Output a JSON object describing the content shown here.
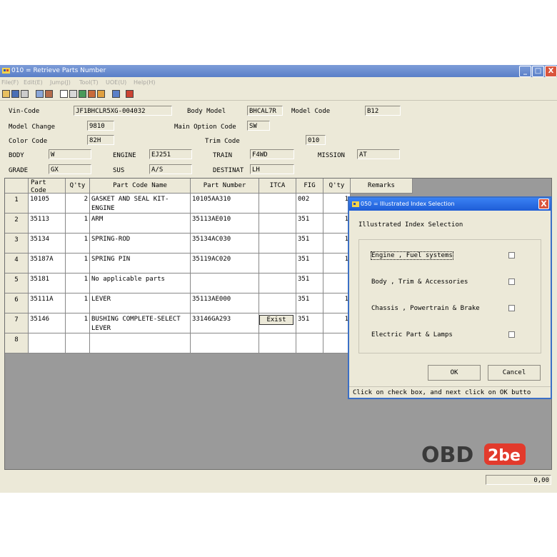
{
  "window": {
    "title": "010 = Retrieve Parts Number",
    "minimize": "_",
    "maximize": "□",
    "close": "X"
  },
  "menu": [
    "File(F)",
    "Edit(E)",
    "Jump(J)",
    "Tool(T)",
    "UOE(U)",
    "Help(H)"
  ],
  "form": {
    "vin_code": {
      "label": "Vin-Code",
      "value": "JF1BHCLR5XG-004032"
    },
    "body_model": {
      "label": "Body Model",
      "value": "BHCAL7R"
    },
    "model_code": {
      "label": "Model Code",
      "value": "B12"
    },
    "model_change": {
      "label": "Model Change",
      "value": "9810"
    },
    "main_option_code": {
      "label": "Main Option Code",
      "value": "SW"
    },
    "color_code": {
      "label": "Color Code",
      "value": "82H"
    },
    "trim_code": {
      "label": "Trim Code",
      "value": "010"
    },
    "body": {
      "label": "BODY",
      "value": "W"
    },
    "engine": {
      "label": "ENGINE",
      "value": "EJ251"
    },
    "train": {
      "label": "TRAIN",
      "value": "F4WD"
    },
    "mission": {
      "label": "MISSION",
      "value": "AT"
    },
    "grade": {
      "label": "GRADE",
      "value": "GX"
    },
    "sus": {
      "label": "SUS",
      "value": "A/S"
    },
    "destinat": {
      "label": "DESTINAT",
      "value": "LH"
    }
  },
  "table": {
    "headers": [
      "Part Code",
      "Q'ty",
      "Part Code Name",
      "Part Number",
      "ITCA",
      "FIG",
      "Q'ty",
      "Remarks"
    ],
    "rows": [
      {
        "n": "1",
        "part_code": "10105",
        "qty": "2",
        "name": "GASKET AND SEAL KIT-ENGINE",
        "part_number": "10105AA310",
        "itca": "",
        "fig": "002",
        "qty2": "1"
      },
      {
        "n": "2",
        "part_code": "35113",
        "qty": "1",
        "name": "ARM",
        "part_number": "35113AE010",
        "itca": "",
        "fig": "351",
        "qty2": "1"
      },
      {
        "n": "3",
        "part_code": "35134",
        "qty": "1",
        "name": "SPRING-ROD",
        "part_number": "35134AC030",
        "itca": "",
        "fig": "351",
        "qty2": "1"
      },
      {
        "n": "4",
        "part_code": "35187A",
        "qty": "1",
        "name": "SPRING PIN",
        "part_number": "35119AC020",
        "itca": "",
        "fig": "351",
        "qty2": "1"
      },
      {
        "n": "5",
        "part_code": "35181",
        "qty": "1",
        "name": "No applicable parts",
        "part_number": "",
        "itca": "",
        "fig": "351",
        "qty2": ""
      },
      {
        "n": "6",
        "part_code": "35111A",
        "qty": "1",
        "name": "LEVER",
        "part_number": "35113AE000",
        "itca": "",
        "fig": "351",
        "qty2": "1"
      },
      {
        "n": "7",
        "part_code": "35146",
        "qty": "1",
        "name": "BUSHING COMPLETE-SELECT LEVER",
        "part_number": "33146GA293",
        "itca": "Exist",
        "fig": "351",
        "qty2": "1"
      },
      {
        "n": "8",
        "part_code": "",
        "qty": "",
        "name": "",
        "part_number": "",
        "itca": "",
        "fig": "",
        "qty2": ""
      }
    ]
  },
  "status": {
    "value": "0,00"
  },
  "dialog": {
    "title": "050 = Illustrated Index Selection",
    "close": "X",
    "heading": "Illustrated Index Selection",
    "options": [
      {
        "label": "Engine , Fuel systems",
        "checked": false
      },
      {
        "label": "Body , Trim & Accessories",
        "checked": false
      },
      {
        "label": "Chassis , Powertrain & Brake",
        "checked": false
      },
      {
        "label": "Electric Part & Lamps",
        "checked": false
      }
    ],
    "ok": "OK",
    "cancel": "Cancel",
    "hint": "Click on check box, and next click on OK butto"
  },
  "watermark": {
    "part1": "OBD",
    "part2": "2be"
  },
  "colors": {
    "title": "#5a7fc8",
    "dialog_title": "#1e5cd6",
    "logo_red": "#e23a2c",
    "logo_dark": "#3a3a3a"
  }
}
